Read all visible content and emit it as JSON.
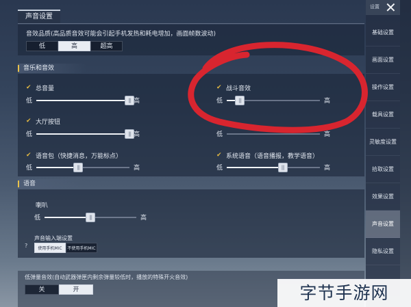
{
  "tab_title": "声音设置",
  "quality": {
    "label": "音效品质(高品质音效可能会引起手机发热和耗电增加，画面帧数波动)",
    "options": [
      "低",
      "高",
      "超高"
    ],
    "selected": "高"
  },
  "music_section": {
    "title": "音乐和音效",
    "controls": [
      {
        "label": "总音量",
        "low": "低",
        "high": "高",
        "value": 1.0
      },
      {
        "label": "战斗音效",
        "low": "低",
        "high": "高",
        "value": 0.14
      },
      {
        "label": "大厅按钮",
        "low": "低",
        "high": "高",
        "value": 1.0
      },
      {
        "label": "",
        "low": "低",
        "high": "高",
        "value": 0.0
      },
      {
        "label": "语音包（快捷消息，万能标点）",
        "low": "低",
        "high": "高",
        "value": 0.45
      },
      {
        "label": "系统语音（语音播报，教学语音）",
        "low": "低",
        "high": "高",
        "value": 0.6
      }
    ]
  },
  "voice_section": {
    "title": "语音",
    "speaker": {
      "label": "喇叭",
      "low": "低",
      "high": "高",
      "value": 0.5
    },
    "input": {
      "label": "声音输入端设置",
      "help": "?",
      "options": [
        "使用手机MIC",
        "不使用手机MIC"
      ],
      "selected": "使用手机MIC"
    }
  },
  "low_ammo": {
    "label": "低弹量音效(自动武器弹匣内剩余弹量较低时，播放的特殊开火音效)",
    "options": [
      "关",
      "开"
    ],
    "selected": "开"
  },
  "sidebar": {
    "top_label": "设置",
    "items": [
      "基础设置",
      "画面设置",
      "操作设置",
      "载具设置",
      "灵敏度设置",
      "拾取设置",
      "效果设置",
      "声音设置",
      "隐私设置"
    ],
    "active": "声音设置"
  },
  "watermark": "字节手游网",
  "colors": {
    "accent_check": "#e2b842",
    "annotation": "#d8252f"
  },
  "icons": {
    "check": "check-icon",
    "close": "close-icon",
    "slider_knob": "slider-knob-icon"
  }
}
